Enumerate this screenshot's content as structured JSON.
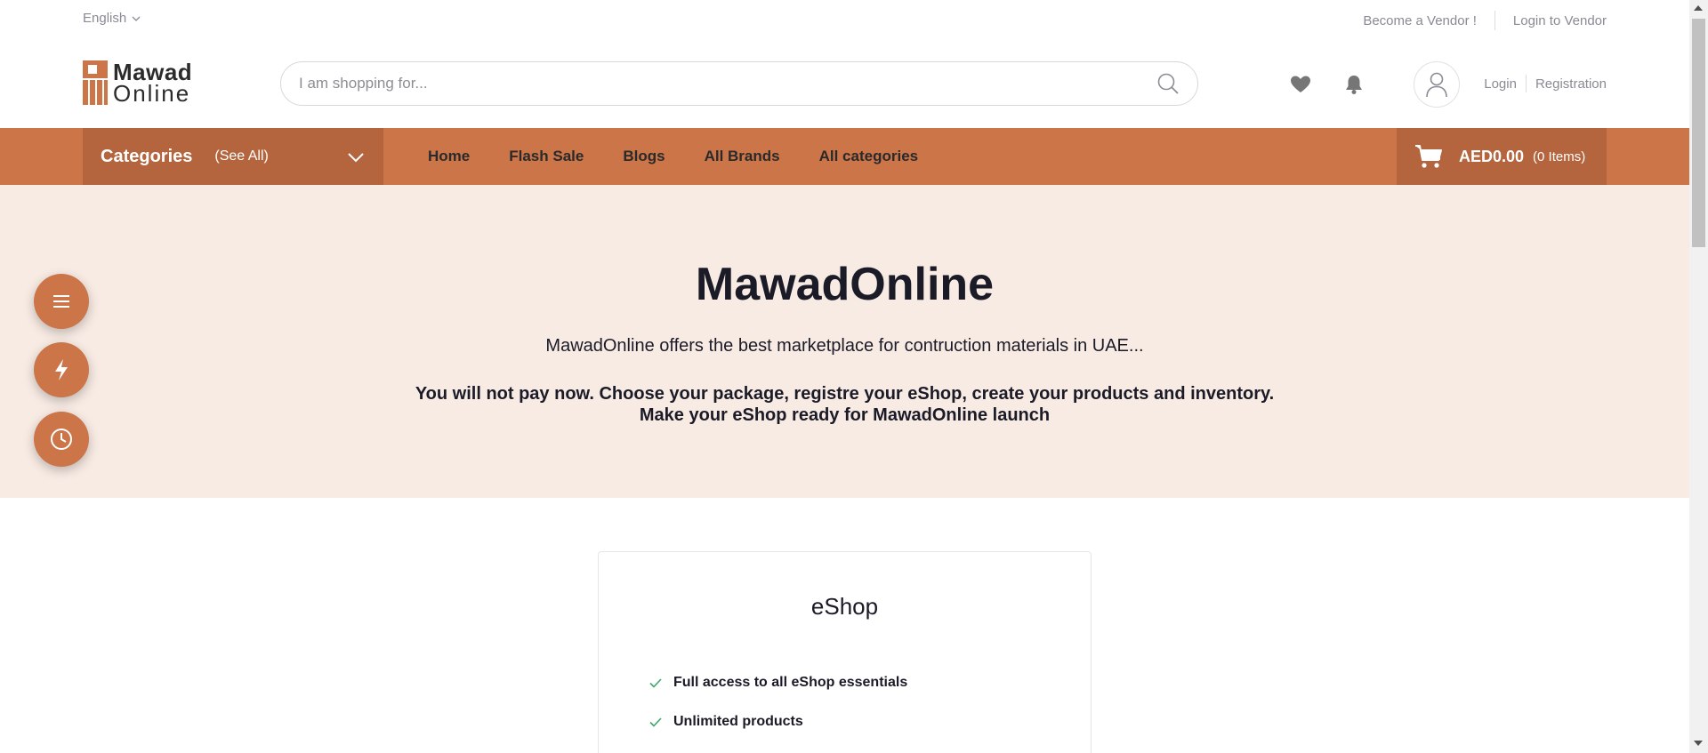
{
  "topbar": {
    "language": "English",
    "become_vendor": "Become a Vendor !",
    "login_vendor": "Login to Vendor"
  },
  "logo": {
    "line1": "Mawad",
    "line2": "Online"
  },
  "search": {
    "placeholder": "I am shopping for..."
  },
  "auth": {
    "login": "Login",
    "registration": "Registration"
  },
  "nav": {
    "categories_title": "Categories",
    "categories_see_all": "(See All)",
    "links": [
      "Home",
      "Flash Sale",
      "Blogs",
      "All Brands",
      "All categories"
    ],
    "cart_amount": "AED0.00",
    "cart_items": "(0 Items)"
  },
  "hero": {
    "title": "MawadOnline",
    "subtitle": "MawadOnline offers the best marketplace for contruction materials in UAE...",
    "note_line1": "You will not pay now. Choose your package, registre your eShop, create your products and inventory.",
    "note_line2": "Make your eShop ready for MawadOnline launch"
  },
  "plan": {
    "title": "eShop",
    "features": [
      "Full access to all eShop essentials",
      "Unlimited products"
    ]
  },
  "colors": {
    "accent": "#cb7549",
    "accent_dark": "#b5653e",
    "hero_bg": "#f8ebe4",
    "check_green": "#3fa66a"
  },
  "icons": {
    "fab": [
      "menu-icon",
      "flash-icon",
      "clock-icon"
    ],
    "header": [
      "heart-icon",
      "bell-icon",
      "user-icon",
      "search-icon",
      "cart-icon"
    ]
  }
}
